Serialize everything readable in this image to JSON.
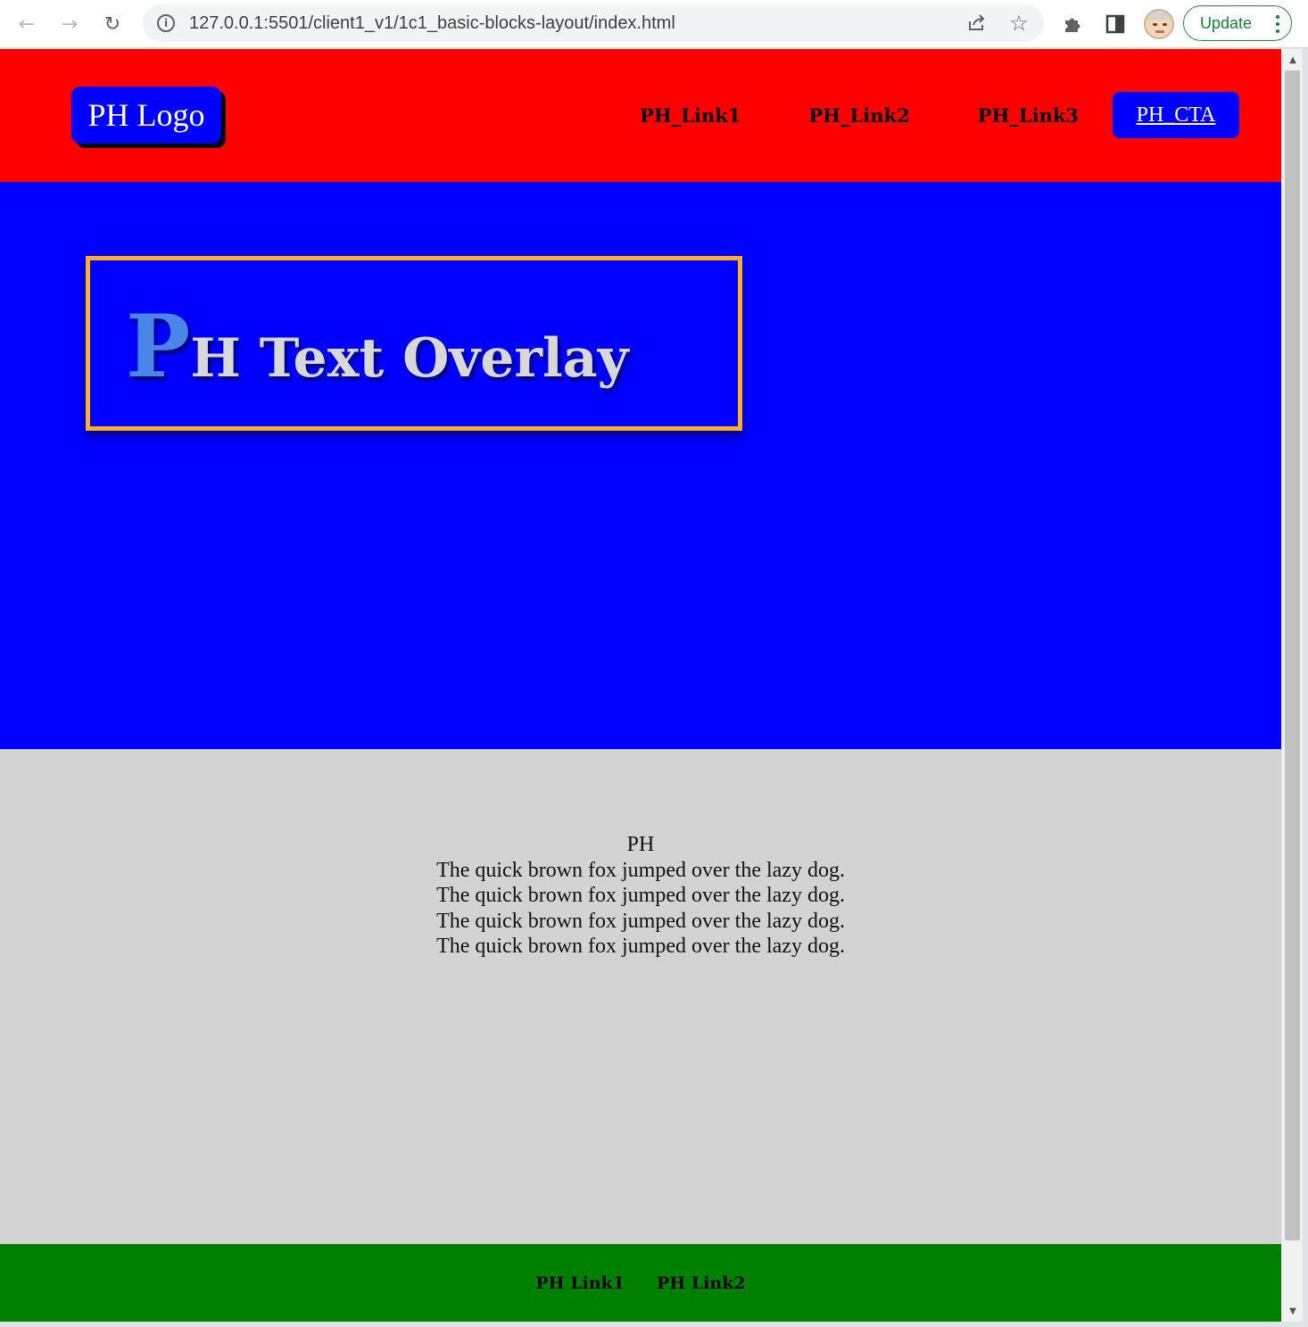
{
  "browser": {
    "url": "127.0.0.1:5501/client1_v1/1c1_basic-blocks-layout/index.html",
    "update_label": "Update",
    "icons": {
      "back": "arrow-left-icon",
      "forward": "arrow-right-icon",
      "reload": "reload-icon",
      "site_info": "info-icon",
      "share": "share-icon",
      "bookmark": "star-icon",
      "extensions": "puzzle-icon",
      "side_panel": "side-panel-icon",
      "menu": "kebab-menu-icon"
    }
  },
  "header": {
    "logo": "PH Logo",
    "nav_links": [
      "PH_Link1",
      "PH_Link2",
      "PH_Link3"
    ],
    "cta": "PH_CTA",
    "background": "#ff0000"
  },
  "hero": {
    "title_initial": "P",
    "title_rest": "H Text Overlay",
    "background": "#0000ff",
    "border_color": "#ffb020"
  },
  "content": {
    "heading": "PH",
    "lines": [
      "The quick brown fox jumped over the lazy dog.",
      "The quick brown fox jumped over the lazy dog.",
      "The quick brown fox jumped over the lazy dog.",
      "The quick brown fox jumped over the lazy dog."
    ],
    "background": "#d3d3d3"
  },
  "footer": {
    "links": [
      "PH Link1",
      "PH Link2"
    ],
    "background": "#008000"
  }
}
